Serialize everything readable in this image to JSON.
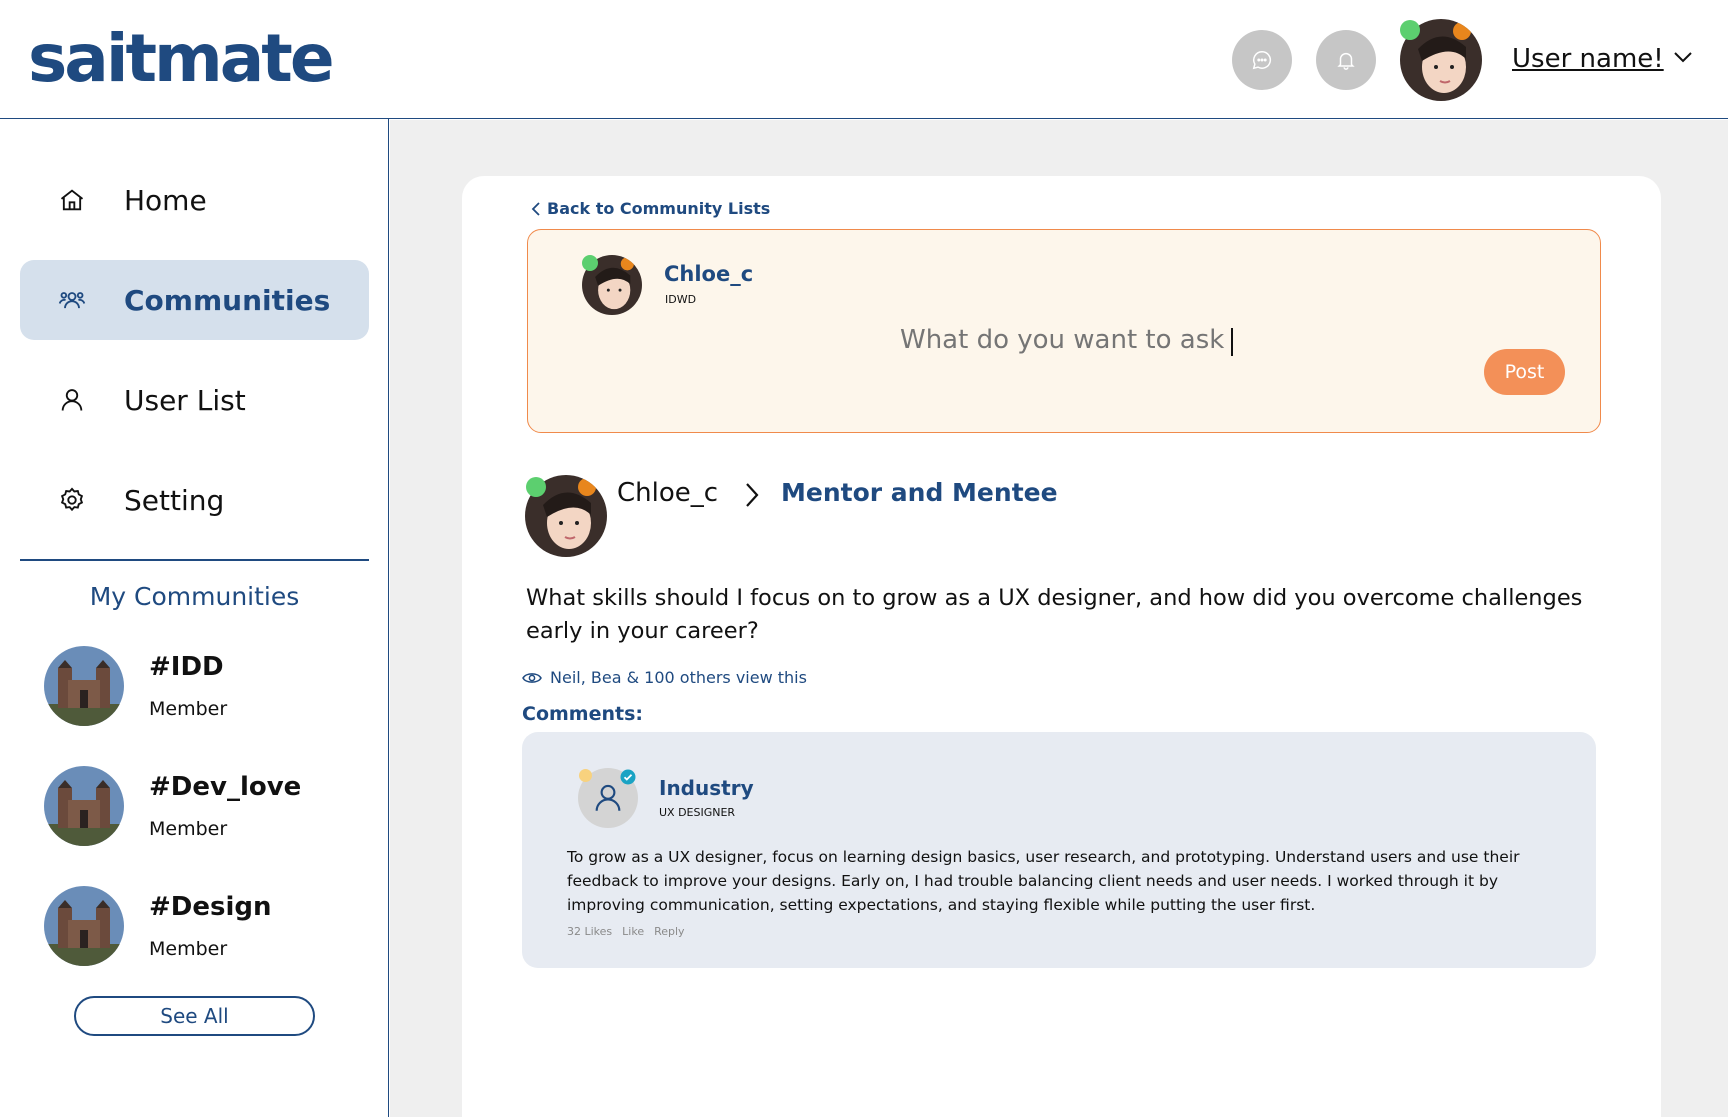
{
  "header": {
    "logo": "saitmate",
    "username": "User name!",
    "icons": [
      "chat-icon",
      "bell-icon",
      "chevron-down-icon"
    ]
  },
  "sidebar": {
    "items": [
      {
        "label": "Home",
        "icon": "home-icon",
        "active": false
      },
      {
        "label": "Communities",
        "icon": "users-icon",
        "active": true
      },
      {
        "label": "User List",
        "icon": "user-icon",
        "active": false
      },
      {
        "label": "Setting",
        "icon": "gear-icon",
        "active": false
      }
    ],
    "my_communities_title": "My Communities",
    "communities": [
      {
        "name": "#IDD",
        "role": "Member"
      },
      {
        "name": "#Dev_love",
        "role": "Member"
      },
      {
        "name": "#Design",
        "role": "Member"
      }
    ],
    "see_all": "See All"
  },
  "main": {
    "back_link": "Back to Community Lists",
    "ask": {
      "author": "Chloe_c",
      "subtitle": "IDWD",
      "placeholder": "What do you want to ask",
      "post_label": "Post"
    },
    "post": {
      "author": "Chloe_c",
      "community": "Mentor and Mentee",
      "text": "What skills should I focus on to grow as a UX designer, and how did you overcome challenges early in your career?",
      "views": "Neil, Bea & 100 others view this"
    },
    "comments_label": "Comments:",
    "comment": {
      "author": "Industry",
      "role": "UX DESIGNER",
      "text": "To grow as a UX designer, focus on learning design basics, user research, and prototyping. Understand users and use their feedback to improve your designs. Early on, I had trouble balancing client needs and user needs. I worked through it by improving communication, setting expectations, and staying flexible while putting the user first.",
      "likes": "32 Likes",
      "like_label": "Like",
      "reply_label": "Reply"
    }
  },
  "colors": {
    "brand": "#1f4a80",
    "accent_orange": "#f39058",
    "online": "#5ccf6f",
    "sidebar_active": "#d5e0ec"
  }
}
